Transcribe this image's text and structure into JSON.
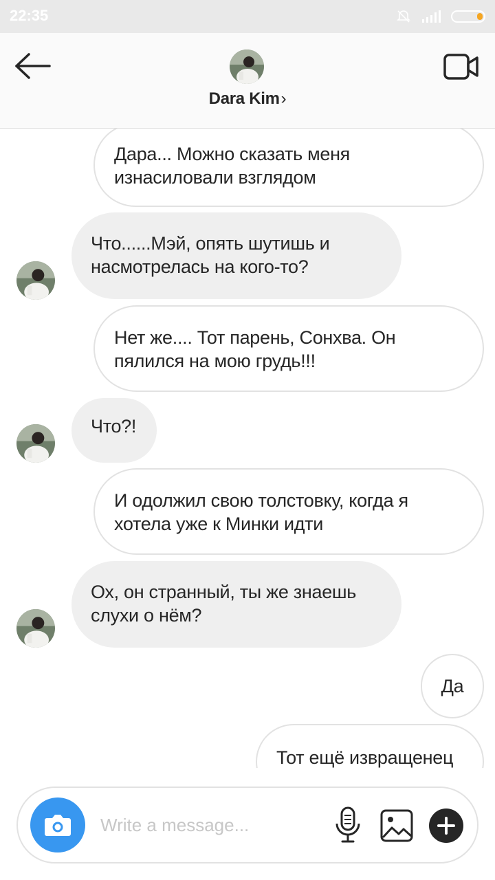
{
  "status_bar": {
    "time": "22:35"
  },
  "header": {
    "contact_name": "Dara Kim",
    "chevron": "›"
  },
  "messages": [
    {
      "side": "sent",
      "lines": [
        "Дара... Можно сказать меня",
        "изнасиловали взглядом"
      ]
    },
    {
      "side": "received",
      "lines": [
        "Что......Мэй, опять шутишь и",
        "насмотрелась на кого-то?"
      ]
    },
    {
      "side": "sent",
      "lines": [
        "Нет же.... Тот парень, Сонхва. Он",
        "пялился на мою грудь!!!"
      ]
    },
    {
      "side": "received",
      "lines": [
        "Что?!"
      ]
    },
    {
      "side": "sent",
      "lines": [
        "И одолжил свою толстовку, когда я",
        "хотела уже к Минки идти"
      ]
    },
    {
      "side": "received",
      "lines": [
        "Ох, он странный, ты же знаешь",
        "слухи о нём?"
      ]
    },
    {
      "side": "sent",
      "lines": [
        "Да"
      ]
    },
    {
      "side": "sent",
      "lines": [
        "Тот ещё извращенец"
      ]
    }
  ],
  "composer": {
    "placeholder": "Write a message..."
  },
  "icons": {
    "back": "arrow-left-icon",
    "video": "video-camera-icon",
    "camera": "camera-icon",
    "mic": "microphone-icon",
    "gallery": "image-icon",
    "plus": "plus-icon"
  },
  "colors": {
    "accent": "#3897f0",
    "received_bubble": "#efefef",
    "sent_border": "#e2e2e2"
  }
}
